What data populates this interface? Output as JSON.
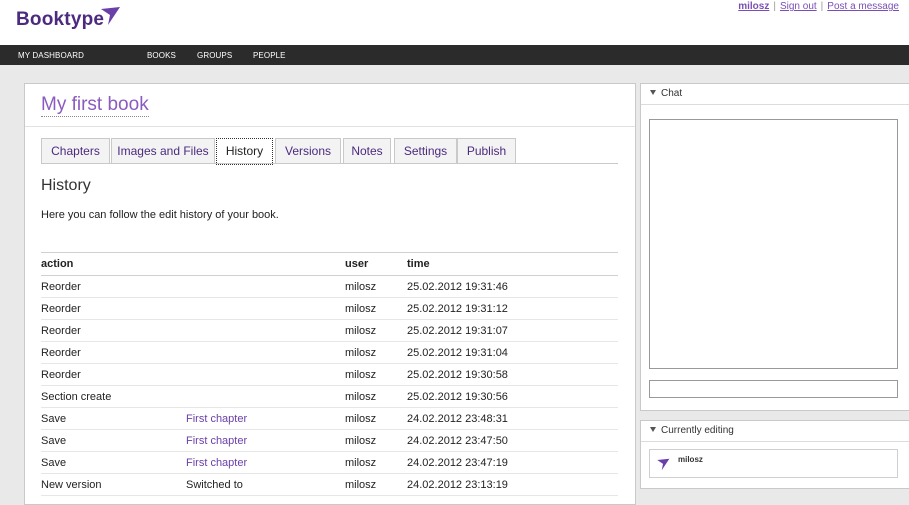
{
  "header": {
    "logo": "Booktype",
    "user": "milosz",
    "sign_out": "Sign out",
    "post_message": "Post a message",
    "separator": "|"
  },
  "nav": [
    "MY DASHBOARD",
    "BOOKS",
    "GROUPS",
    "PEOPLE"
  ],
  "book": {
    "title": "My first book",
    "tabs": [
      "Chapters",
      "Images and Files",
      "History",
      "Versions",
      "Notes",
      "Settings",
      "Publish"
    ],
    "active_tab": "History",
    "history": {
      "heading": "History",
      "intro": "Here you can follow the edit history of your book.",
      "columns": [
        "action",
        "user",
        "time"
      ],
      "rows": [
        {
          "action": "Reorder",
          "target": "",
          "user": "milosz",
          "time": "25.02.2012 19:31:46"
        },
        {
          "action": "Reorder",
          "target": "",
          "user": "milosz",
          "time": "25.02.2012 19:31:12"
        },
        {
          "action": "Reorder",
          "target": "",
          "user": "milosz",
          "time": "25.02.2012 19:31:07"
        },
        {
          "action": "Reorder",
          "target": "",
          "user": "milosz",
          "time": "25.02.2012 19:31:04"
        },
        {
          "action": "Reorder",
          "target": "",
          "user": "milosz",
          "time": "25.02.2012 19:30:58"
        },
        {
          "action": "Section create",
          "target": "",
          "user": "milosz",
          "time": "25.02.2012 19:30:56"
        },
        {
          "action": "Save",
          "target": "First chapter",
          "user": "milosz",
          "time": "24.02.2012 23:48:31"
        },
        {
          "action": "Save",
          "target": "First chapter",
          "user": "milosz",
          "time": "24.02.2012 23:47:50"
        },
        {
          "action": "Save",
          "target": "First chapter",
          "user": "milosz",
          "time": "24.02.2012 23:47:19"
        },
        {
          "action": "New version",
          "target": "Switched to",
          "user": "milosz",
          "time": "24.02.2012 23:13:19"
        }
      ]
    }
  },
  "side": {
    "chat_label": "Chat",
    "editing_label": "Currently editing",
    "editing_user": "milosz"
  },
  "colors": {
    "brand": "#4b2a7f",
    "link": "#7a4fb5",
    "navbar": "#2b2b2b"
  }
}
